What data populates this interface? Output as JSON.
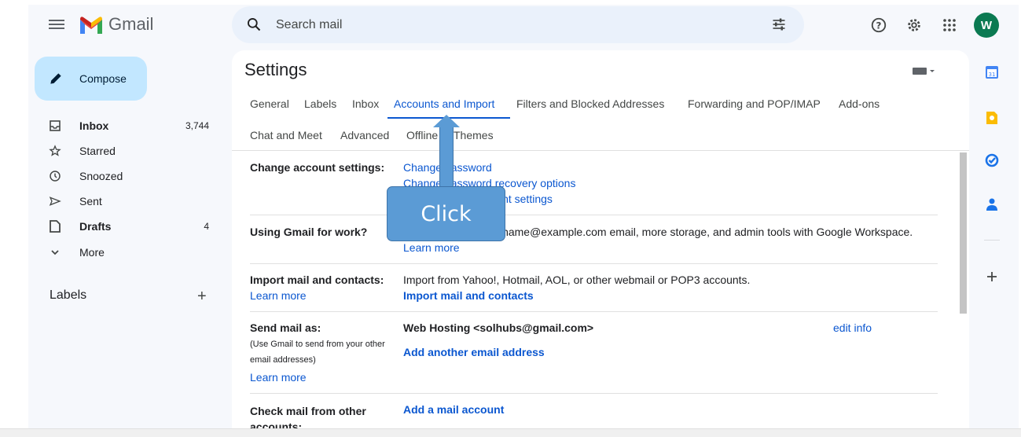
{
  "header": {
    "app_name": "Gmail",
    "search_placeholder": "Search mail",
    "avatar_letter": "W"
  },
  "nav": {
    "compose_label": "Compose",
    "items": [
      {
        "label": "Inbox",
        "count": "3,744",
        "icon": "inbox-icon",
        "bold": true
      },
      {
        "label": "Starred",
        "count": "",
        "icon": "star-icon",
        "bold": false
      },
      {
        "label": "Snoozed",
        "count": "",
        "icon": "clock-icon",
        "bold": false
      },
      {
        "label": "Sent",
        "count": "",
        "icon": "send-icon",
        "bold": false
      },
      {
        "label": "Drafts",
        "count": "4",
        "icon": "draft-icon",
        "bold": true
      },
      {
        "label": "More",
        "count": "",
        "icon": "chevron-down-icon",
        "bold": false
      }
    ],
    "labels_title": "Labels",
    "labels_add": "+"
  },
  "settings": {
    "title": "Settings",
    "tabs": [
      "General",
      "Labels",
      "Inbox",
      "Accounts and Import",
      "Filters and Blocked Addresses",
      "Forwarding and POP/IMAP",
      "Add-ons",
      "Chat and Meet",
      "Advanced",
      "Offline",
      "Themes"
    ],
    "active_tab": "Accounts and Import",
    "rows": {
      "change_account": {
        "label": "Change account settings:",
        "links": [
          "Change password",
          "Change password recovery options",
          "Other Google Account settings"
        ]
      },
      "work": {
        "label": "Using Gmail for work?",
        "text": "Businesses get yourname@example.com email, more storage, and admin tools with Google Workspace.",
        "link": "Learn more"
      },
      "import": {
        "label": "Import mail and contacts:",
        "learn_more": "Learn more",
        "text": "Import from Yahoo!, Hotmail, AOL, or other webmail or POP3 accounts.",
        "action": "Import mail and contacts"
      },
      "send_as": {
        "label": "Send mail as:",
        "sub": "(Use Gmail to send from your other email addresses)",
        "learn_more": "Learn more",
        "identity": "Web Hosting <solhubs@gmail.com>",
        "edit": "edit info",
        "add": "Add another email address"
      },
      "check_mail": {
        "label": "Check mail from other accounts:",
        "action": "Add a mail account"
      }
    }
  },
  "overlay": {
    "callout": "Click"
  },
  "colors": {
    "accent": "#0b57d0",
    "compose_bg": "#c2e7ff",
    "avatar_bg": "#0b7a52",
    "callout_bg": "#5b9bd5"
  }
}
